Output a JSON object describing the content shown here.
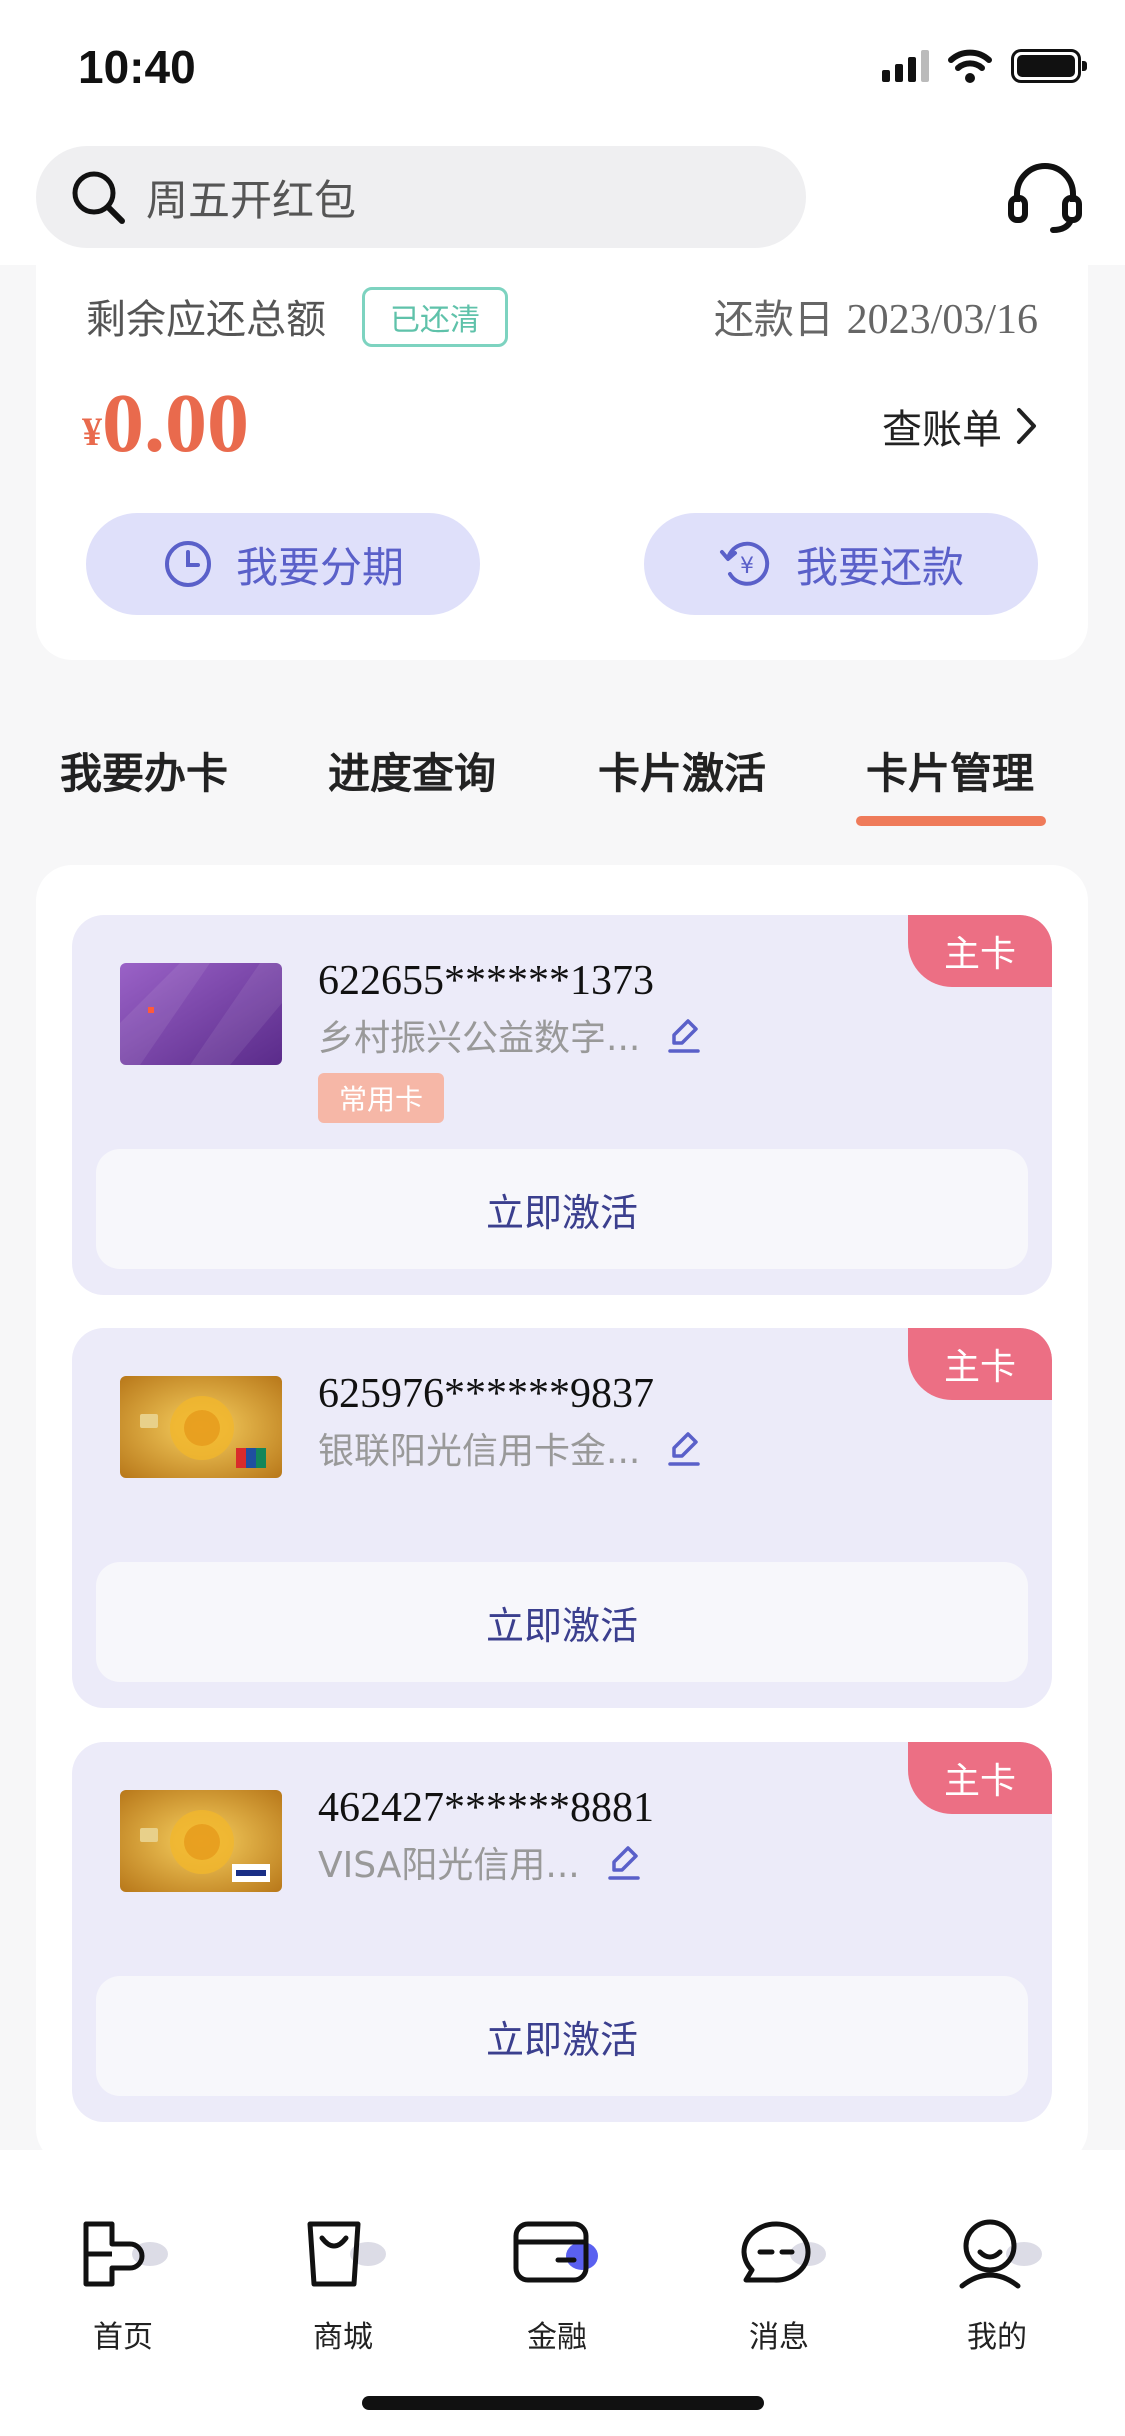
{
  "status_bar": {
    "time": "10:40"
  },
  "search": {
    "placeholder": "周五开红包"
  },
  "bill": {
    "label": "剩余应还总额",
    "status": "已还清",
    "due_label": "还款日",
    "due_date": "2023/03/16",
    "currency": "¥",
    "amount": "0.00",
    "statement_label": "查账单",
    "installment_label": "我要分期",
    "repay_label": "我要还款"
  },
  "tabs": [
    {
      "label": "我要办卡"
    },
    {
      "label": "进度查询"
    },
    {
      "label": "卡片激活"
    },
    {
      "label": "卡片管理",
      "active": true
    }
  ],
  "cards": [
    {
      "number": "622655******1373",
      "name": "乡村振兴公益数字...",
      "badge": "主卡",
      "tag": "常用卡",
      "action": "立即激活",
      "thumb": "purple-card"
    },
    {
      "number": "625976******9837",
      "name": "银联阳光信用卡金...",
      "badge": "主卡",
      "action": "立即激活",
      "thumb": "gold-card-unionpay"
    },
    {
      "number": "462427******8881",
      "name": "VISA阳光信用...",
      "badge": "主卡",
      "action": "立即激活",
      "thumb": "gold-card-visa"
    }
  ],
  "nav": [
    {
      "label": "首页",
      "icon": "home-icon"
    },
    {
      "label": "商城",
      "icon": "shop-icon"
    },
    {
      "label": "金融",
      "icon": "wallet-icon",
      "active": true
    },
    {
      "label": "消息",
      "icon": "message-icon"
    },
    {
      "label": "我的",
      "icon": "profile-icon"
    }
  ],
  "colors": {
    "accent": "#ef7b5a",
    "amount": "#e96a4d",
    "badge": "#ec6f84",
    "pill_bg": "#dfe0fa",
    "pill_text": "#5a60c9",
    "paid": "#5fc2aa"
  }
}
